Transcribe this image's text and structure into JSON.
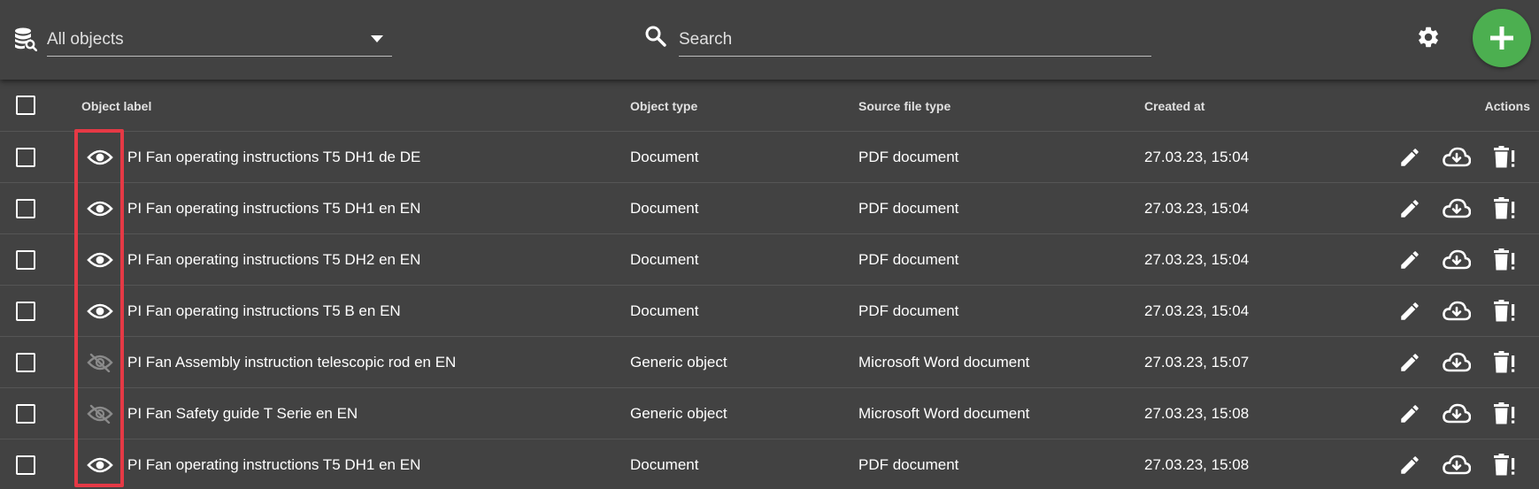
{
  "toolbar": {
    "filter_value": "All objects",
    "search_placeholder": "Search",
    "icons": {
      "filter": "database-search-icon",
      "dropdown": "caret-down-icon",
      "search": "magnifier-icon",
      "settings": "gear-icon",
      "add": "plus-icon"
    },
    "add_button_color": "#4caf50"
  },
  "table": {
    "columns": [
      "Object label",
      "Object type",
      "Source file type",
      "Created at",
      "Actions"
    ],
    "rows": [
      {
        "visible": true,
        "label": "PI Fan operating instructions T5 DH1 de DE",
        "type": "Document",
        "source": "PDF document",
        "created": "27.03.23, 15:04"
      },
      {
        "visible": true,
        "label": "PI Fan operating instructions T5 DH1 en EN",
        "type": "Document",
        "source": "PDF document",
        "created": "27.03.23, 15:04"
      },
      {
        "visible": true,
        "label": "PI Fan operating instructions T5 DH2 en EN",
        "type": "Document",
        "source": "PDF document",
        "created": "27.03.23, 15:04"
      },
      {
        "visible": true,
        "label": "PI Fan operating instructions T5 B en EN",
        "type": "Document",
        "source": "PDF document",
        "created": "27.03.23, 15:04"
      },
      {
        "visible": false,
        "label": "PI Fan Assembly instruction telescopic rod en EN",
        "type": "Generic object",
        "source": "Microsoft Word document",
        "created": "27.03.23, 15:07"
      },
      {
        "visible": false,
        "label": "PI Fan Safety guide T Serie en EN",
        "type": "Generic object",
        "source": "Microsoft Word document",
        "created": "27.03.23, 15:08"
      },
      {
        "visible": true,
        "label": "PI Fan operating instructions T5 DH1 en EN",
        "type": "Document",
        "source": "PDF document",
        "created": "27.03.23, 15:08"
      }
    ],
    "row_icons": {
      "visible": "eye-icon",
      "hidden": "eye-off-icon",
      "edit": "pencil-icon",
      "download": "cloud-download-icon",
      "delete": "trash-alert-icon"
    }
  },
  "colors": {
    "background": "#424242",
    "highlight": "#e53945",
    "visible_eye": "#ffffff",
    "hidden_eye": "#8a8a8a"
  }
}
